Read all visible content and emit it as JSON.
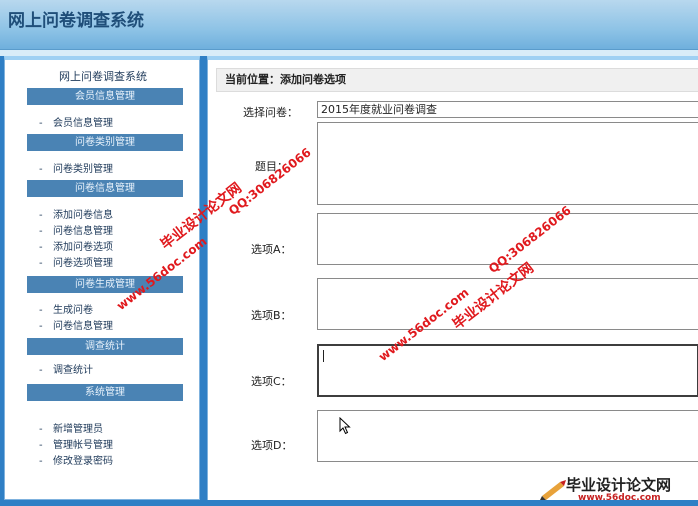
{
  "header": {
    "title": "网上问卷调查系统"
  },
  "sidebar": {
    "title": "网上问卷调查系统",
    "sections": [
      {
        "header": "会员信息管理",
        "items": [
          {
            "label": "会员信息管理"
          }
        ]
      },
      {
        "header": "问卷类别管理",
        "items": [
          {
            "label": "问卷类别管理"
          }
        ]
      },
      {
        "header": "问卷信息管理",
        "items": [
          {
            "label": "添加问卷信息"
          },
          {
            "label": "问卷信息管理"
          },
          {
            "label": "添加问卷选项"
          },
          {
            "label": "问卷选项管理"
          }
        ]
      },
      {
        "header": "问卷生成管理",
        "items": [
          {
            "label": "生成问卷"
          },
          {
            "label": "问卷信息管理"
          }
        ]
      },
      {
        "header": "调查统计",
        "items": [
          {
            "label": "调查统计"
          }
        ]
      },
      {
        "header": "系统管理",
        "items": [
          {
            "label": "新增管理员"
          },
          {
            "label": "管理帐号管理"
          },
          {
            "label": "修改登录密码"
          }
        ]
      }
    ]
  },
  "main": {
    "breadcrumb": "当前位置：添加问卷选项",
    "form": {
      "select_label": "选择问卷：",
      "select_value": "2015年度就业问卷调查",
      "question_label": "题目：",
      "option_a_label": "选项A：",
      "option_b_label": "选项B：",
      "option_c_label": "选项C：",
      "option_d_label": "选项D："
    }
  },
  "watermarks": {
    "site_name": "毕业设计论文网",
    "url": "www.56doc.com",
    "qq": "QQ:306826066"
  },
  "footer_logo": {
    "text": "毕业设计论文网",
    "url": "www.56doc.com"
  },
  "colors": {
    "header_top": "#b8d8ee",
    "frame_blue": "#2f7fc5",
    "section_header": "#4a83b4",
    "watermark_red": "#e0191d"
  }
}
